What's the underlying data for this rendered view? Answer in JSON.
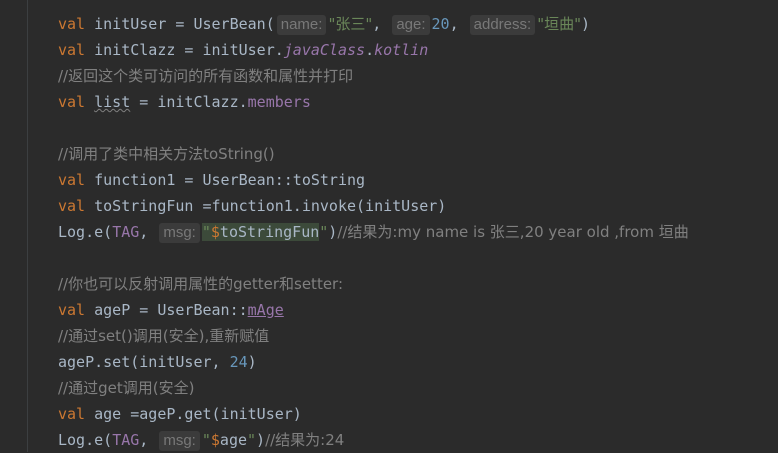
{
  "code": {
    "l1": {
      "kw": "val",
      "a": " initUser = UserBean(",
      "h1": "name:",
      "s1": "\"张三\"",
      "c1": ", ",
      "h2": "age:",
      "n1": "20",
      "c2": ", ",
      "h3": "address:",
      "s2": "\"垣曲\"",
      "e": ")"
    },
    "l2": {
      "kw": "val",
      "a": " initClazz = initUser.",
      "p1": "javaClass",
      "dot": ".",
      "p2": "kotlin"
    },
    "l3": {
      "cmt": "//返回这个类可访问的所有函数和属性并打印"
    },
    "l4": {
      "kw": "val",
      "sp": " ",
      "warn": "list",
      "a": " = initClazz.",
      "p": "members"
    },
    "l6": {
      "cmt": "//调用了类中相关方法toString()"
    },
    "l7": {
      "kw": "val",
      "a": " function1 = UserBean::toString"
    },
    "l8": {
      "kw": "val",
      "a": " toStringFun =function1.invoke(initUser)"
    },
    "l9": {
      "a": "Log.e(",
      "tag": "TAG",
      "c": ", ",
      "h": "msg:",
      "q1": "\"",
      "var": "$",
      "v": "toStringFun",
      "q2": "\"",
      "e": ")",
      "cmt": "//结果为:my name is 张三,20 year old ,from 垣曲"
    },
    "l11": {
      "cmt": "//你也可以反射调用属性的getter和setter:"
    },
    "l12": {
      "kw": "val",
      "a": " ageP = UserBean::",
      "p": "mAge"
    },
    "l13": {
      "cmt": "//通过set()调用(安全),重新赋值"
    },
    "l14": {
      "a": "ageP.set(initUser, ",
      "n": "24",
      "e": ")"
    },
    "l15": {
      "cmt": "//通过get调用(安全)"
    },
    "l16": {
      "kw": "val",
      "a": " age =ageP.get(initUser)"
    },
    "l17": {
      "a": "Log.e(",
      "tag": "TAG",
      "c": ", ",
      "h": "msg:",
      "q1": "\"",
      "var": "$",
      "v": "age",
      "q2": "\"",
      "e": ")",
      "cmt": "//结果为:24"
    }
  }
}
